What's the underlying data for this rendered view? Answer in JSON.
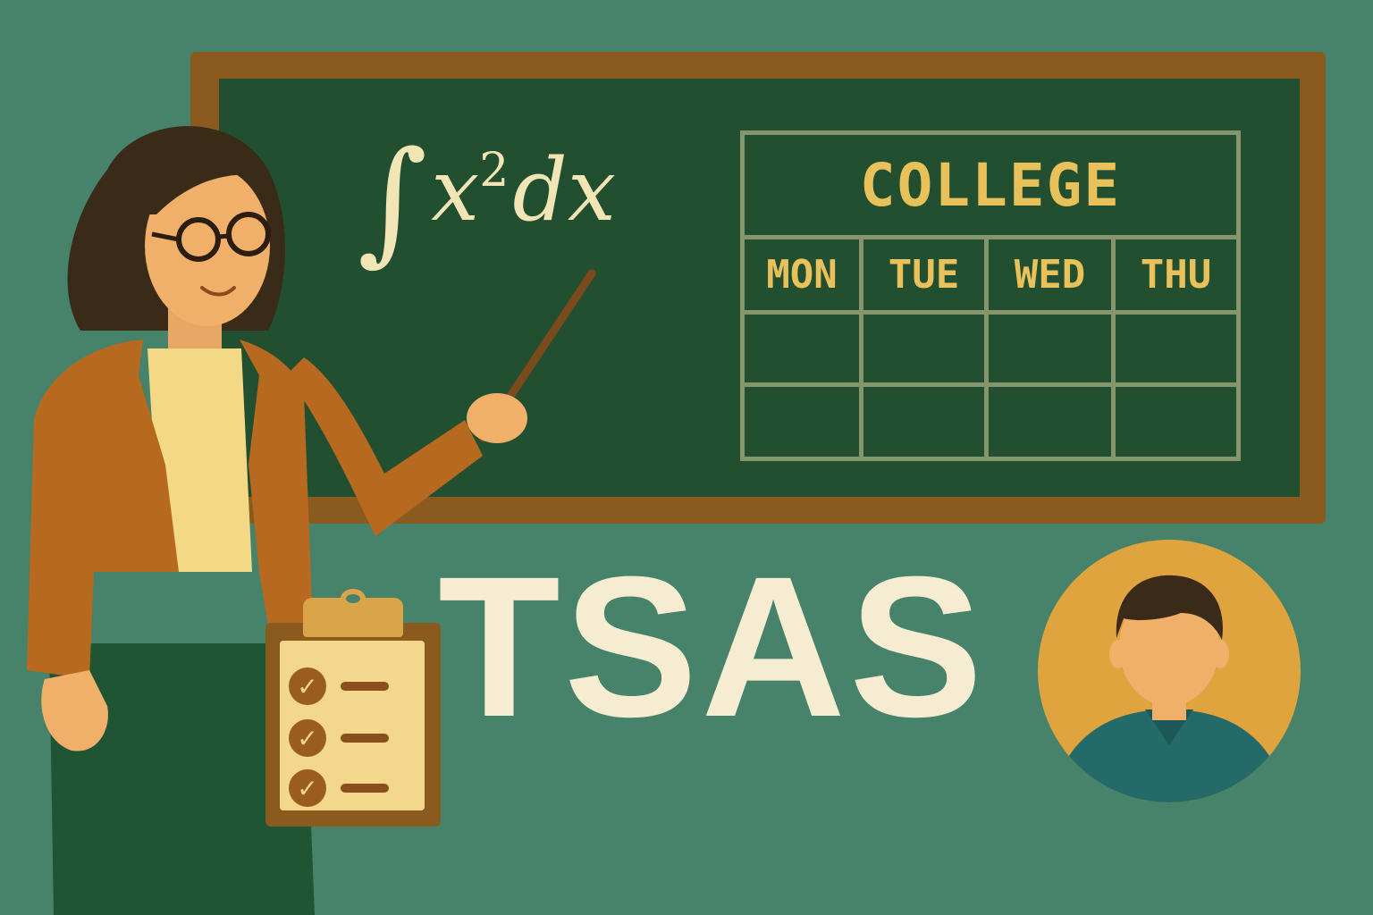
{
  "chalkboard": {
    "formula": {
      "integral": "∫",
      "base": "x",
      "exponent": "2",
      "differential": "dx"
    },
    "schedule": {
      "title": "COLLEGE",
      "days": [
        "MON",
        "TUE",
        "WED",
        "THU"
      ],
      "empty_rows": 2
    }
  },
  "brand": {
    "text": "TSAS"
  },
  "clipboard": {
    "checked_items": 3
  },
  "colors": {
    "background": "#46836a",
    "board": "#214f30",
    "frame": "#8a5a1f",
    "chalk": "#f1e5b5",
    "accent_yellow": "#e8c15b",
    "brand_text": "#f5ecd1",
    "avatar_bg": "#e0a43f"
  },
  "icons": {
    "teacher": "teacher-illustration",
    "pointer": "pointer-stick-icon",
    "clipboard": "clipboard-checklist-icon",
    "avatar": "user-avatar-icon"
  }
}
